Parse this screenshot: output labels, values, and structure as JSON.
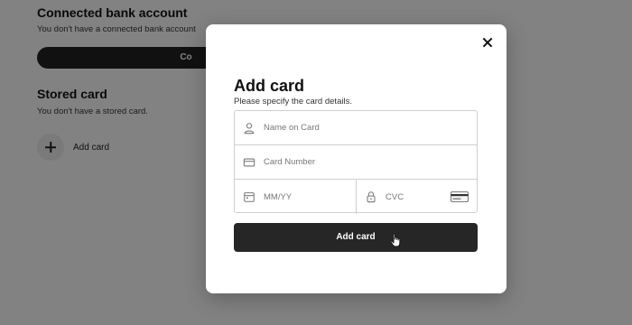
{
  "background": {
    "bank_section": {
      "title": "Connected bank account",
      "subtitle": "You don't have a connected bank account",
      "button_label": "Co"
    },
    "stored_section": {
      "title": "Stored card",
      "subtitle": "You don't have a stored card.",
      "add_label": "Add card"
    }
  },
  "modal": {
    "title": "Add card",
    "subtitle": "Please specify the card details.",
    "fields": {
      "name": {
        "placeholder": "Name on Card",
        "icon": "user-icon"
      },
      "number": {
        "placeholder": "Card Number",
        "icon": "credit-card-icon"
      },
      "expiry": {
        "placeholder": "MM/YY",
        "icon": "calendar-icon"
      },
      "cvc": {
        "placeholder": "CVC",
        "icon": "lock-icon",
        "brand_icon": "card-brand-icon"
      }
    },
    "submit_label": "Add card",
    "close_icon": "close-icon"
  },
  "colors": {
    "overlay": "#000000",
    "button": "#262626",
    "modal_bg": "#ffffff"
  }
}
